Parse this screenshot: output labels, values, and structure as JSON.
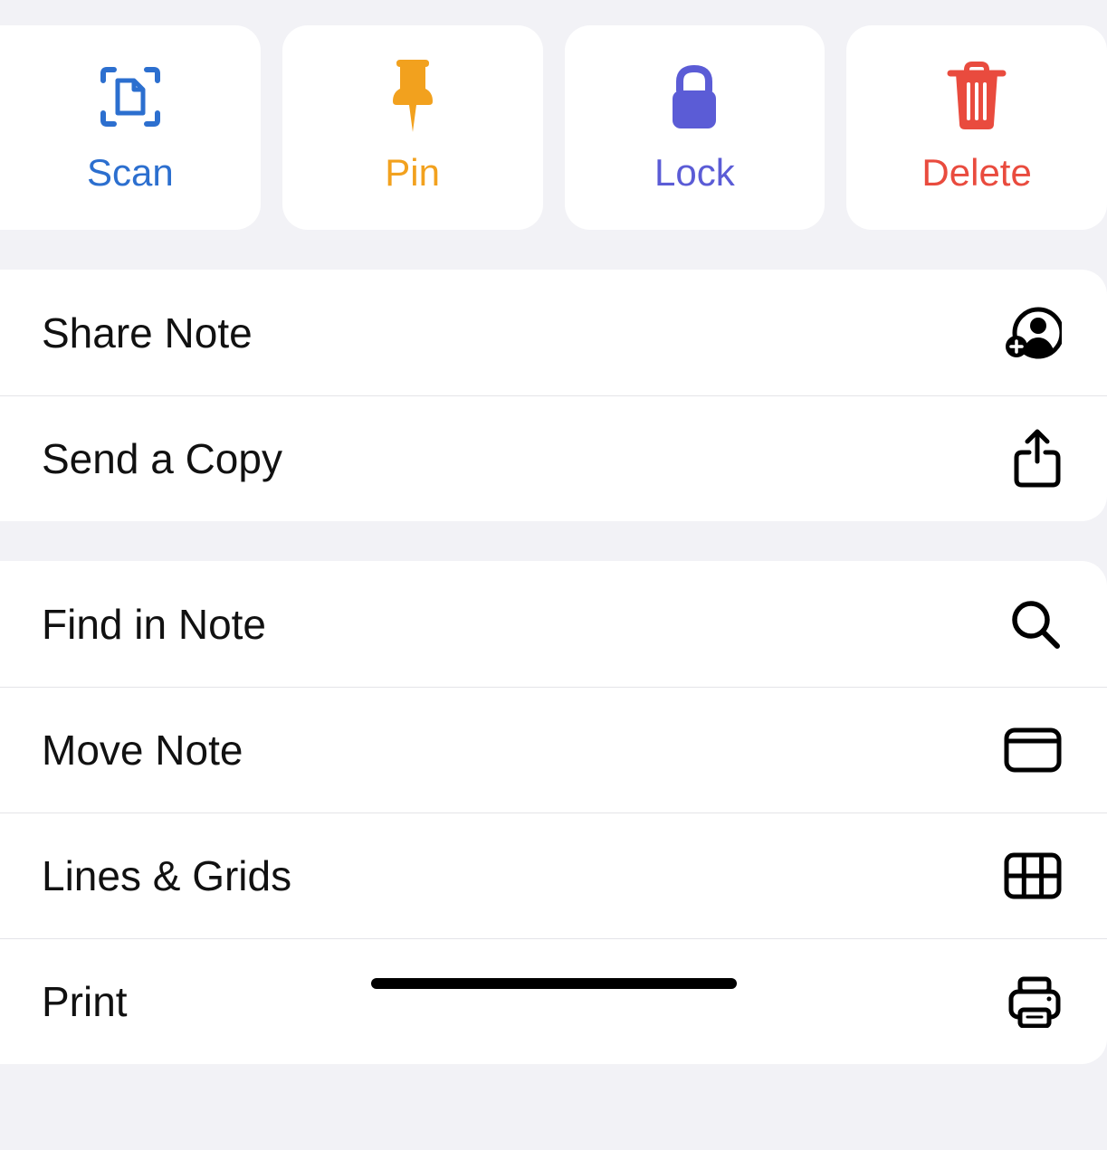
{
  "actions": {
    "scan": {
      "label": "Scan"
    },
    "pin": {
      "label": "Pin"
    },
    "lock": {
      "label": "Lock"
    },
    "delete": {
      "label": "Delete"
    }
  },
  "menu_group_1": {
    "share_note": {
      "label": "Share Note"
    },
    "send_copy": {
      "label": "Send a Copy"
    }
  },
  "menu_group_2": {
    "find_in_note": {
      "label": "Find in Note"
    },
    "move_note": {
      "label": "Move Note"
    },
    "lines_grids": {
      "label": "Lines & Grids"
    },
    "print": {
      "label": "Print"
    }
  },
  "colors": {
    "scan": "#2c6fcf",
    "pin": "#f2a11e",
    "lock": "#5b5cd6",
    "delete": "#e94b3e",
    "background": "#f2f2f6"
  }
}
